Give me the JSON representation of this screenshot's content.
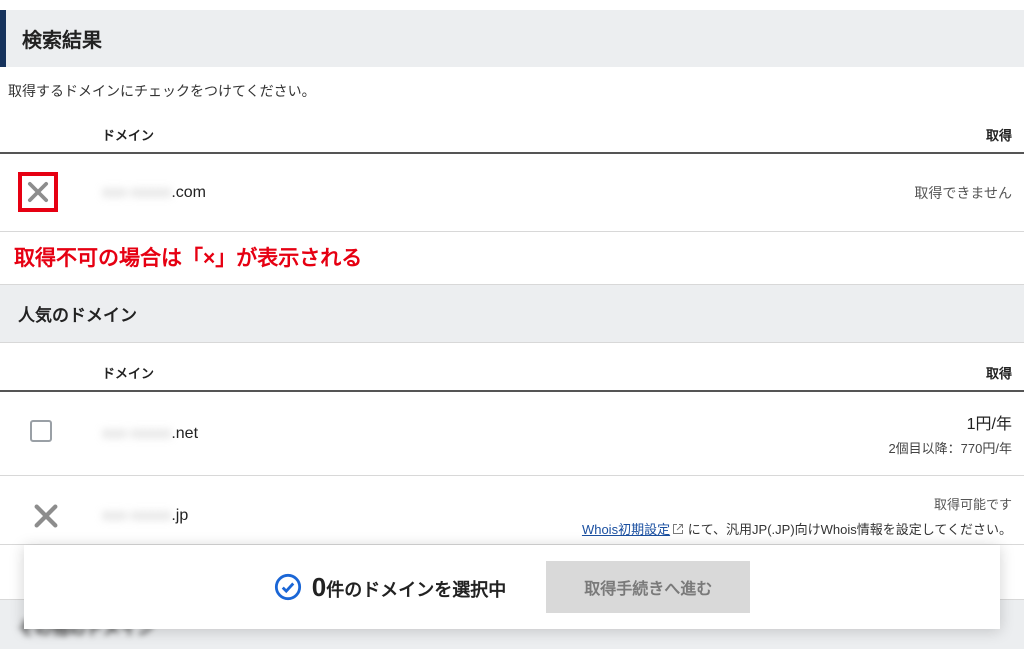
{
  "title": "検索結果",
  "instruction": "取得するドメインにチェックをつけてください。",
  "columns": {
    "domain": "ドメイン",
    "status": "取得"
  },
  "annotation": "取得不可の場合は「×」が表示される",
  "sections": {
    "popular": "人気のドメイン",
    "hidden": "その他のドメイン"
  },
  "rows": {
    "com": {
      "domain_masked": "xxx-xxxxx",
      "tld": ".com",
      "status": "取得できません"
    },
    "net": {
      "domain_masked": "xxx-xxxxx",
      "tld": ".net",
      "price_main": "1円/年",
      "price_sub": "2個目以降：770円/年"
    },
    "jp": {
      "domain_masked": "xxx-xxxxx",
      "tld": ".jp",
      "status": "取得可能です",
      "whois_link": "Whois初期設定",
      "whois_rest": " にて、汎用JP(.JP)向けWhois情報を設定してください。"
    }
  },
  "footer": {
    "count": "0",
    "count_suffix": "件のドメインを選択中",
    "proceed": "取得手続きへ進む"
  }
}
